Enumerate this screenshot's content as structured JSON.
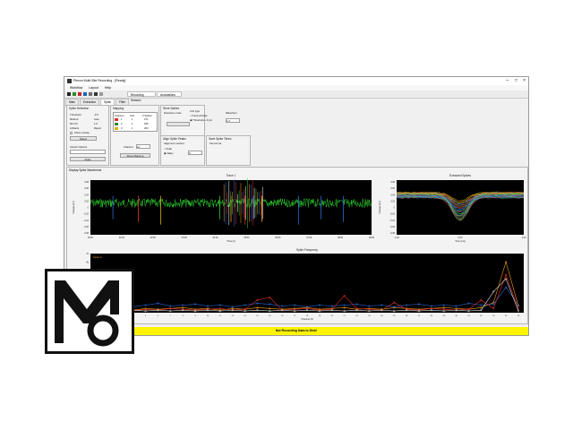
{
  "window": {
    "title": "Plexon Multi-Site Recording - [Ready]",
    "menu": [
      "Workflow",
      "Layout",
      "Help"
    ],
    "doc_tabs": [
      "Recording Session",
      "Annotations"
    ],
    "sub_tabs": [
      "Main",
      "Extraction",
      "Spike",
      "Filter"
    ],
    "active_sub_tab": "Spike"
  },
  "panels": {
    "controls": {
      "header": "Spike Detection",
      "rows": [
        {
          "label": "Threshold",
          "value": "-4.5"
        },
        {
          "label": "Method",
          "value": "Auto"
        },
        {
          "label": "Min ISI",
          "value": "1.0"
        },
        {
          "label": "Artifacts",
          "value": "Reject"
        }
      ],
      "check_label": "Show overlay",
      "button": "Detect",
      "group_label": "Cluster Options",
      "group_button": "Apply"
    },
    "units_table": {
      "header": "Mapping",
      "columns": [
        "Channel",
        "Unit",
        "# Spikes"
      ],
      "rows": [
        {
          "swatch": "#e23030",
          "ch": "1",
          "unit": "1",
          "count": "271"
        },
        {
          "swatch": "#2f8a2f",
          "ch": "2",
          "unit": "1",
          "count": "186"
        },
        {
          "swatch": "#d8b400",
          "ch": "3",
          "unit": "1",
          "count": "202"
        }
      ],
      "channel_label": "Channel",
      "channel_value": "12",
      "button": "Reset Mapping"
    },
    "spike_opts": {
      "header": "Store Spikes",
      "sub1": "Detection mode",
      "radios": [
        "Fixed window",
        "Threshold + 3 pts"
      ],
      "sub2": "Waveform",
      "value": "1.0"
    },
    "align": {
      "header": "Align Spike Peaks",
      "sub": "Alignment method",
      "radios": [
        "Peak",
        "Valley"
      ],
      "value": "0"
    },
    "export": {
      "header": "Save Spike Times",
      "sub": "File format",
      "value": ""
    }
  },
  "display": {
    "header": "Display Spike Waveforms",
    "trace_title": "Trace 1",
    "trace_xlabel": "Time (s)",
    "trace_ylabel": "Voltage (uV)",
    "waveform_title": "Extracted Spikes",
    "waveform_xlabel": "Time (ms)",
    "waveform_ylabel": "Voltage (uV)",
    "rate_title": "Spike Frequency",
    "rate_xlabel": "Channel (#)",
    "rate_ylabel": "Hz",
    "rate_legend": "Series A"
  },
  "status": "Not Recording Data to Disk!",
  "logo_text": "Mo",
  "colors": {
    "trace_bg": "#000000",
    "trace_line": "#2ed12e",
    "status_bg": "#fff400"
  },
  "chart_data": [
    {
      "type": "line",
      "title": "Trace 1",
      "x_ticks": [
        "00:00",
        "01:00",
        "02:00",
        "03:00",
        "04:00",
        "05:00",
        "06:00",
        "07:00",
        "08:00",
        "09:00"
      ],
      "y_ticks": [
        "0.08",
        "0.06",
        "0.04",
        "0.02",
        "0",
        "-0.02",
        "-0.04",
        "-0.06",
        "-0.08"
      ],
      "grid": false
    },
    {
      "type": "line",
      "title": "Extracted Spikes",
      "x_ticks": [
        "-1.00",
        "0.00",
        "1.00"
      ],
      "y_ticks": [
        "0.08",
        "0.06",
        "0.04",
        "0.02",
        "0",
        "-0.02",
        "-0.04",
        "-0.06",
        "-0.08"
      ],
      "grid": false
    },
    {
      "type": "line",
      "title": "Spike Frequency",
      "categories": [
        "1",
        "2",
        "3",
        "4",
        "5",
        "6",
        "7",
        "8",
        "9",
        "10",
        "11",
        "12",
        "13",
        "14",
        "15",
        "16",
        "17",
        "18",
        "19",
        "20",
        "21",
        "22",
        "23",
        "24",
        "25",
        "26",
        "27",
        "28",
        "29",
        "30",
        "31",
        "32",
        "33",
        "34",
        "35"
      ],
      "ylim": [
        0,
        70
      ],
      "series": [
        {
          "color": "#f39c12",
          "values": [
            5,
            4,
            6,
            3,
            5,
            4,
            5,
            6,
            4,
            5,
            3,
            5,
            4,
            6,
            5,
            4,
            5,
            6,
            4,
            5,
            6,
            4,
            5,
            4,
            6,
            5,
            4,
            5,
            6,
            5,
            4,
            6,
            12,
            60,
            8
          ]
        },
        {
          "color": "#2a6bd8",
          "values": [
            12,
            8,
            10,
            7,
            9,
            11,
            8,
            9,
            10,
            8,
            9,
            7,
            9,
            11,
            10,
            8,
            9,
            7,
            9,
            8,
            9,
            10,
            8,
            9,
            7,
            9,
            10,
            8,
            9,
            8,
            11,
            9,
            10,
            30,
            9
          ]
        },
        {
          "color": "#e23030",
          "values": [
            3,
            4,
            5,
            2,
            4,
            3,
            5,
            4,
            3,
            4,
            5,
            3,
            4,
            15,
            18,
            3,
            4,
            5,
            3,
            4,
            20,
            5,
            4,
            3,
            12,
            4,
            3,
            5,
            4,
            3,
            4,
            15,
            5,
            45,
            4
          ]
        },
        {
          "color": "#d8d8d8",
          "values": [
            2,
            3,
            2,
            3,
            2,
            3,
            2,
            3,
            2,
            3,
            2,
            3,
            2,
            3,
            2,
            3,
            2,
            3,
            2,
            3,
            2,
            3,
            2,
            3,
            2,
            3,
            2,
            3,
            2,
            3,
            2,
            3,
            25,
            40,
            2
          ]
        }
      ],
      "grid": false
    }
  ]
}
